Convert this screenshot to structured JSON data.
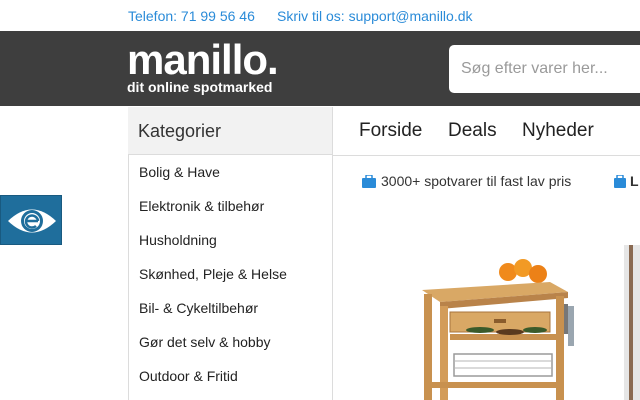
{
  "topbar": {
    "phone": "Telefon: 71 99 56 46",
    "mail": "Skriv til os: support@manillo.dk"
  },
  "header": {
    "logo_name": "manillo.",
    "logo_tagline": "dit online spotmarked",
    "search_placeholder": "Søg efter varer her..."
  },
  "accessibility": {
    "icon": "eye-icon"
  },
  "categories": {
    "title": "Kategorier",
    "items": [
      "Bolig & Have",
      "Elektronik & tilbehør",
      "Husholdning",
      "Skønhed, Pleje & Helse",
      "Bil- & Cykeltilbehør",
      "Gør det selv & hobby",
      "Outdoor & Fritid"
    ]
  },
  "nav": {
    "items": [
      "Forside",
      "Deals",
      "Nyheder"
    ]
  },
  "usp": {
    "first": "3000+ spotvarer til fast lav pris",
    "second": "L",
    "icon": "briefcase-icon"
  },
  "colors": {
    "link": "#2a8bd8",
    "header_bg": "#3e3e3e",
    "badge_bg": "#1f6e9c"
  }
}
